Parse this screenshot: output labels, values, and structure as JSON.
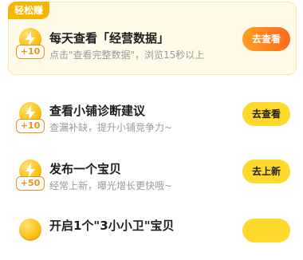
{
  "featured": {
    "tag": "轻松赚",
    "points": "+10",
    "title": "每天查看「经营数据」",
    "desc": "点击\"查看完整数据\"，浏览15秒以上",
    "button": "去查看",
    "accent_color": "#ff7a1e"
  },
  "tasks": [
    {
      "points": "+10",
      "title": "查看小铺诊断建议",
      "desc": "查漏补缺，提升小铺竞争力~",
      "button": "去查看"
    },
    {
      "points": "+50",
      "title": "发布一个宝贝",
      "desc": "经常上新，曝光增长更快哦~",
      "button": "去上新"
    },
    {
      "points": "",
      "title": "开启1个\"3小小卫\"宝贝",
      "desc": "",
      "button": ""
    }
  ],
  "icons": {
    "coin": "lightning-coin-icon"
  }
}
